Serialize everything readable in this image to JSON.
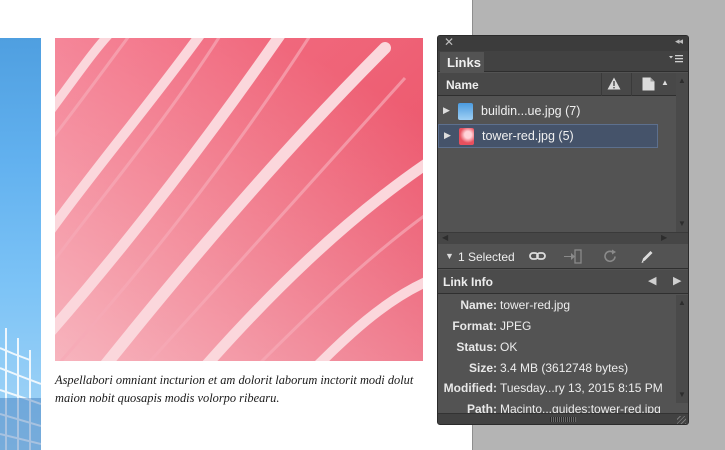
{
  "document": {
    "caption_lines": [
      "Aspellabori omniant incturion et am dolorit laborum inctorit modi dolut",
      "maion nobit quosapis modis volorpo ribearu."
    ]
  },
  "panel": {
    "title": "Links",
    "close_glyph": "✕",
    "collapse_glyph": "◂◂",
    "columns": {
      "name": "Name"
    },
    "links": [
      {
        "label": "buildin...ue.jpg (7)",
        "thumb_color": "#6ab2ea",
        "selected": false
      },
      {
        "label": "tower-red.jpg (5)",
        "thumb_color": "#e8505e",
        "selected": true
      }
    ],
    "selection_count": "1 Selected",
    "link_info": {
      "title": "Link Info",
      "fields": [
        {
          "key": "Name:",
          "value": "tower-red.jpg"
        },
        {
          "key": "Format:",
          "value": "JPEG"
        },
        {
          "key": "Status:",
          "value": "OK"
        },
        {
          "key": "Size:",
          "value": "3.4 MB (3612748 bytes)"
        },
        {
          "key": "Modified:",
          "value": "Tuesday...ry 13, 2015 8:15 PM"
        },
        {
          "key": "Path:",
          "value": "Macinto...guides:tower-red.jpg"
        }
      ]
    },
    "colors": {
      "panel_bg": "#535353",
      "selection": "#45536a",
      "text": "#eeeeee"
    }
  }
}
